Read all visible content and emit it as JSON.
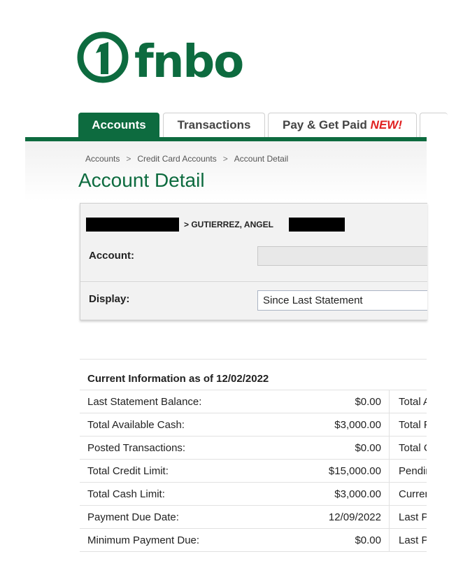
{
  "brand": {
    "name": "fnbo",
    "color": "#0d6b3f"
  },
  "tabs": [
    {
      "label": "Accounts",
      "active": true
    },
    {
      "label": "Transactions",
      "active": false
    },
    {
      "label": "Pay & Get Paid",
      "badge": "NEW!",
      "active": false
    }
  ],
  "breadcrumb": [
    "Accounts",
    ">",
    "Credit Card Accounts",
    ">",
    "Account Detail"
  ],
  "page_title": "Account Detail",
  "account_panel": {
    "account_path": "> GUTIERREZ, ANGEL",
    "account_label": "Account:",
    "account_value": "",
    "display_label": "Display:",
    "display_value": "Since Last Statement"
  },
  "current_info": {
    "heading": "Current Information as of 12/02/2022",
    "rows": [
      {
        "label": "Last Statement Balance:",
        "value": "$0.00",
        "right_label": "Total Av"
      },
      {
        "label": "Total Available Cash:",
        "value": "$3,000.00",
        "right_label": "Total Pa"
      },
      {
        "label": "Posted Transactions:",
        "value": "$0.00",
        "right_label": "Total Cr"
      },
      {
        "label": "Total Credit Limit:",
        "value": "$15,000.00",
        "right_label": "Pending"
      },
      {
        "label": "Total Cash Limit:",
        "value": "$3,000.00",
        "right_label": "Current"
      },
      {
        "label": "Payment Due Date:",
        "value": "12/09/2022",
        "right_label": "Last Pa"
      },
      {
        "label": "Minimum Payment Due:",
        "value": "$0.00",
        "right_label": "Last Pa"
      }
    ]
  }
}
